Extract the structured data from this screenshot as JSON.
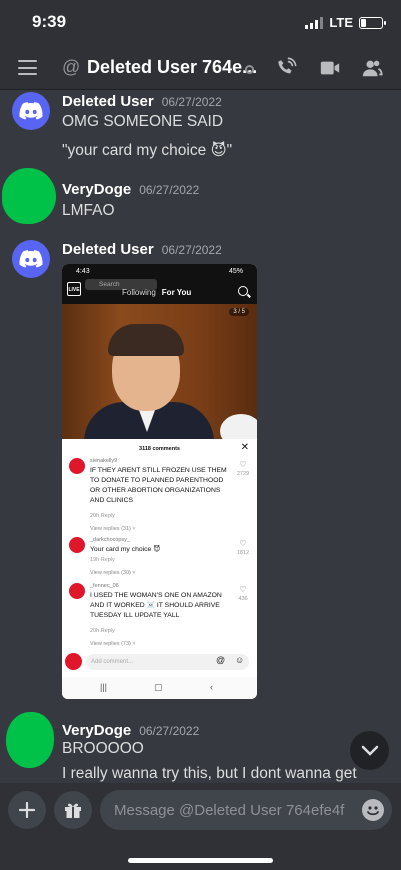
{
  "status_bar": {
    "time": "9:39",
    "network": "LTE",
    "battery_level": 0.25
  },
  "header": {
    "at_symbol": "@",
    "title": "Deleted User 764e...",
    "icons": [
      "menu-icon",
      "call-icon",
      "video-icon",
      "members-icon"
    ]
  },
  "messages": [
    {
      "author": "Deleted User",
      "timestamp": "06/27/2022",
      "lines": [
        "OMG SOMEONE SAID",
        "\"your card my choice 😈\""
      ]
    },
    {
      "author": "VeryDoge",
      "timestamp": "06/27/2022",
      "lines": [
        "LMFAO"
      ]
    },
    {
      "author": "Deleted User",
      "timestamp": "06/27/2022",
      "lines": []
    },
    {
      "author": "VeryDoge",
      "timestamp": "06/27/2022",
      "lines": [
        "BROOOOO",
        "I really wanna try this, but I dont wanna get"
      ]
    }
  ],
  "embed": {
    "status_time": "4:43",
    "status_right": "45%",
    "live_label": "LIVE",
    "search_placeholder": "Search",
    "tab_following": "Following",
    "tab_for_you": "For You",
    "counter": "3 / 5",
    "comments_title": "3118 comments",
    "comments": [
      {
        "user": "sienakelly9",
        "text": "IF THEY ARENT STILL FROZEN USE THEM TO DONATE TO PLANNED PARENTHOOD OR OTHER ABORTION ORGANIZATIONS AND CLINICS",
        "meta": "20h   Reply",
        "likes": "2729",
        "replies": "View replies (31) ˅"
      },
      {
        "user": "_darkchocopsy_",
        "text": "Your card my choice 😈",
        "meta": "19h   Reply",
        "likes": "1812",
        "replies": "View replies (30) ˅"
      },
      {
        "user": "_fennec_06",
        "text": "I USED THE WOMAN'S ONE ON AMAZON AND IT WORKED ☠️ IT SHOULD ARRIVE TUESDAY ILL UPDATE YALL",
        "meta": "20h   Reply",
        "likes": "436",
        "replies": "View replies (73) ˅"
      }
    ],
    "add_comment_placeholder": "Add comment..."
  },
  "composer": {
    "placeholder": "Message @Deleted User 764efe4f"
  },
  "colors": {
    "background": "#36393f",
    "header": "#2f3136",
    "blurple": "#5865f2",
    "avatar_green": "#00c249"
  }
}
